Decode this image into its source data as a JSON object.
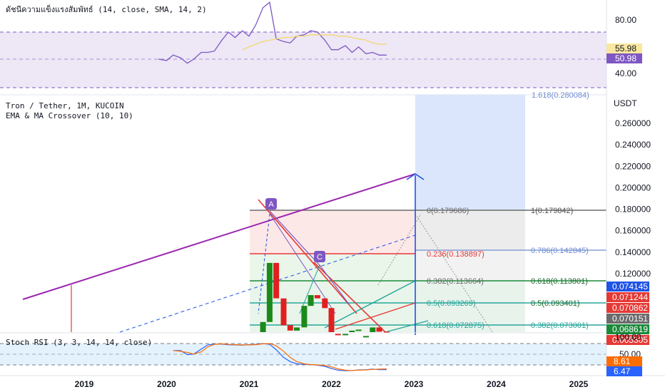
{
  "colors": {
    "rsi_line": "#7e57c2",
    "rsi_ma": "#f5d76e",
    "rsi_band": "#ede7f6",
    "stoch_k": "#2962ff",
    "stoch_d": "#ff6d00",
    "bull": "#26a69a",
    "bear": "#ef5350",
    "candle_green": "#1b8a1b",
    "candle_red": "#e02020",
    "channel": "#9c27b0",
    "projection": "#1e53e5"
  },
  "rsi_panel": {
    "title": "ดัชนีความแข็งแรงสัมพัทธ์ (14, close, SMA, 14, 2)",
    "ticks": [
      "80.00",
      "40.00"
    ],
    "badges": [
      {
        "text": "55.98",
        "color": "#f9e79f",
        "text_color": "#131722"
      },
      {
        "text": "50.98",
        "color": "#7e57c2",
        "text_color": "#ffffff"
      }
    ]
  },
  "price_panel": {
    "title": "Tron / Tether, 1M, KUCOIN",
    "subtitle": "EMA & MA Crossover (10, 10)",
    "unit": "USDT",
    "ticks": [
      "0.260000",
      "0.240000",
      "0.220000",
      "0.200000",
      "0.180000",
      "0.160000",
      "0.140000",
      "0.120000"
    ],
    "top_cut_label": "1.618(0.280084)",
    "badges": [
      {
        "text": "0.074145",
        "color": "#1e53e5"
      },
      {
        "text": "0.071244",
        "color": "#e53935"
      },
      {
        "text": "0.070862",
        "color": "#e53935"
      },
      {
        "text": "0.070151",
        "color": "#6b6b6b"
      },
      {
        "text": "0.068619",
        "color": "#1b8a3a"
      },
      {
        "text": "0.065305",
        "color": "#e53935"
      }
    ],
    "markers": [
      "A",
      "C"
    ],
    "fib_left": [
      "0(0.179686)",
      "0.236(0.138897)",
      "0.382(0.113664)",
      "0.5(0.093269)",
      "0.618(0.072875)"
    ],
    "fib_right": [
      "1(0.179842)",
      "0.786(0.142845)",
      "0.618(0.113801)",
      "0.5(0.093401)",
      "0.382(0.073001)"
    ]
  },
  "stoch_panel": {
    "title": "Stoch RSI (3, 3, 14, 14, close)",
    "ticks": [
      "100.00",
      "50.00"
    ],
    "badges": [
      {
        "text": "8.61",
        "color": "#ff6d00"
      },
      {
        "text": "6.47",
        "color": "#2962ff"
      }
    ]
  },
  "x_axis": {
    "labels": [
      "2019",
      "2020",
      "2021",
      "2022",
      "2023",
      "2024",
      "2025"
    ]
  },
  "chart_data": [
    {
      "type": "line",
      "title": "ดัชนีความแข็งแรงสัมพัทธ์ (14, close, SMA, 14, 2)",
      "ylim": [
        30,
        95
      ],
      "series": [
        {
          "x": [
            2019.9,
            2020.0,
            2020.08,
            2020.17,
            2020.25,
            2020.33,
            2020.42,
            2020.5,
            2020.58,
            2020.67,
            2020.75,
            2020.83,
            2020.92,
            2021.0,
            2021.08,
            2021.17,
            2021.25,
            2021.33,
            2021.42,
            2021.5,
            2021.58,
            2021.67,
            2021.75,
            2021.83,
            2021.92,
            2022.0,
            2022.08,
            2022.17,
            2022.25,
            2022.33,
            2022.42,
            2022.5,
            2022.58,
            2022.67
          ],
          "values": [
            50,
            49,
            53,
            51,
            47,
            50,
            55,
            55,
            56,
            64,
            70,
            66,
            71,
            67,
            75,
            88,
            92,
            65,
            63,
            62,
            67,
            68,
            71,
            70,
            64,
            57,
            57,
            60,
            55,
            59,
            54,
            55,
            53,
            53
          ]
        },
        {
          "x": [
            2020.92,
            2021.0,
            2021.08,
            2021.17,
            2021.25,
            2021.33,
            2021.42,
            2021.5,
            2021.58,
            2021.67,
            2021.75,
            2021.83,
            2021.92,
            2022.0,
            2022.08,
            2022.17,
            2022.25,
            2022.33,
            2022.42,
            2022.5,
            2022.58,
            2022.67
          ],
          "values": [
            57,
            59,
            61,
            63,
            64,
            65,
            66,
            66,
            67,
            67,
            68,
            68,
            68,
            68,
            67,
            67,
            66,
            65,
            64,
            62,
            61,
            61
          ]
        }
      ]
    },
    {
      "type": "bar",
      "title": "Tron / Tether, 1M, KUCOIN",
      "ylim": [
        0.058,
        0.285
      ],
      "x": [
        2021.17,
        2021.25,
        2021.33,
        2021.42,
        2021.5,
        2021.58,
        2021.67,
        2021.75,
        2021.83,
        2021.92,
        2022.0,
        2022.08,
        2022.17,
        2022.25,
        2022.33,
        2022.42,
        2022.5,
        2022.58,
        2022.67
      ],
      "open": [
        0.06,
        0.075,
        0.13,
        0.097,
        0.072,
        0.067,
        0.07,
        0.09,
        0.1,
        0.097,
        0.088,
        0.064,
        0.062,
        0.064,
        0.067,
        0.06,
        0.062,
        0.07,
        0.066
      ],
      "close": [
        0.075,
        0.13,
        0.097,
        0.072,
        0.067,
        0.07,
        0.09,
        0.1,
        0.097,
        0.088,
        0.064,
        0.062,
        0.064,
        0.067,
        0.068,
        0.062,
        0.07,
        0.066,
        0.065
      ]
    },
    {
      "type": "line",
      "title": "Stoch RSI (3, 3, 14, 14, close)",
      "ylim": [
        0,
        100
      ],
      "series": [
        {
          "x": [
            2020.08,
            2020.17,
            2020.25,
            2020.33,
            2020.42,
            2020.5,
            2020.58,
            2020.67,
            2020.75,
            2020.83,
            2020.92,
            2021.0,
            2021.08,
            2021.17,
            2021.25,
            2021.33,
            2021.42,
            2021.5,
            2021.58,
            2021.67,
            2021.75,
            2021.83,
            2021.92,
            2022.0,
            2022.08,
            2022.17,
            2022.25,
            2022.33,
            2022.42,
            2022.5,
            2022.58,
            2022.67
          ],
          "values": [
            75,
            75,
            60,
            62,
            80,
            95,
            98,
            98,
            96,
            95,
            94,
            96,
            97,
            100,
            97,
            78,
            50,
            35,
            27,
            25,
            24,
            22,
            18,
            10,
            4,
            2,
            3,
            5,
            6,
            8,
            6,
            6
          ]
        },
        {
          "x": [
            2020.08,
            2020.17,
            2020.25,
            2020.33,
            2020.42,
            2020.5,
            2020.58,
            2020.67,
            2020.75,
            2020.83,
            2020.92,
            2021.0,
            2021.08,
            2021.17,
            2021.25,
            2021.33,
            2021.42,
            2021.5,
            2021.58,
            2021.67,
            2021.75,
            2021.83,
            2021.92,
            2022.0,
            2022.08,
            2022.17,
            2022.25,
            2022.33,
            2022.42,
            2022.5,
            2022.58,
            2022.67
          ],
          "values": [
            75,
            72,
            68,
            62,
            70,
            88,
            97,
            99,
            97,
            96,
            95,
            95,
            96,
            99,
            100,
            92,
            72,
            50,
            35,
            27,
            24,
            23,
            21,
            16,
            9,
            4,
            3,
            4,
            5,
            7,
            8,
            9
          ]
        }
      ]
    }
  ]
}
